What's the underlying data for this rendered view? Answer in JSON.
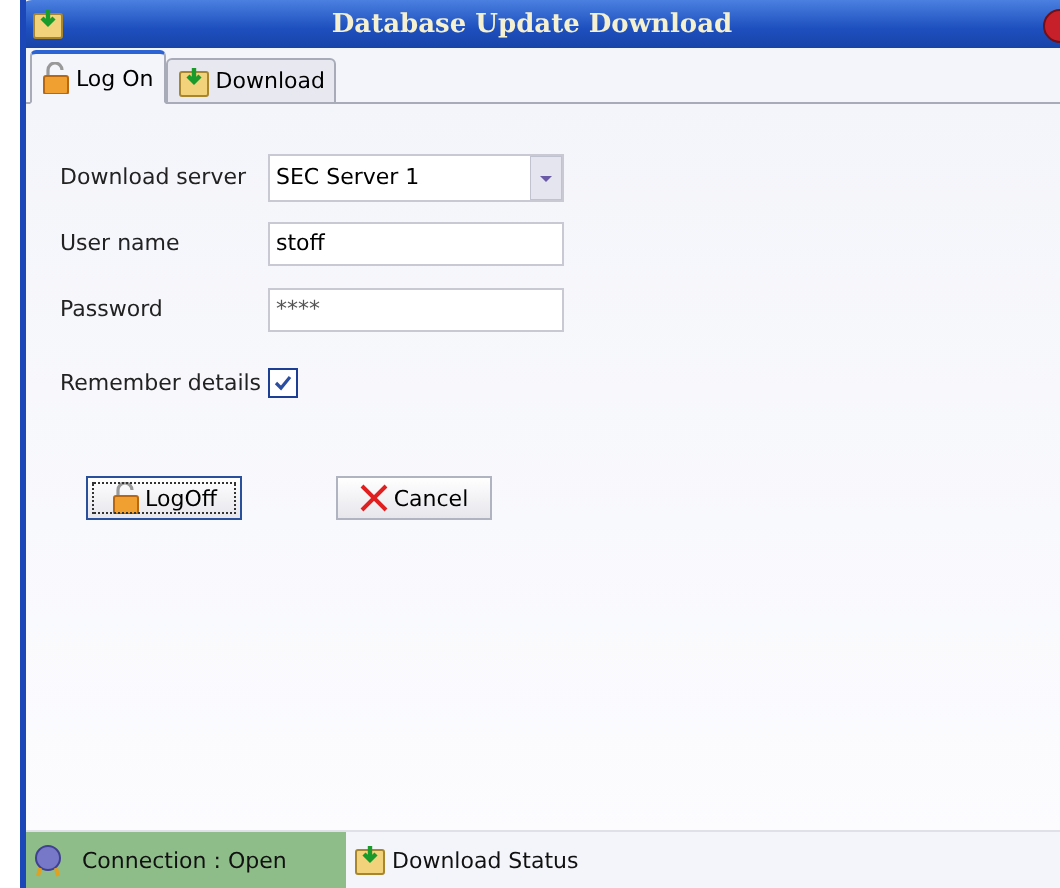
{
  "window": {
    "title": "Database Update Download"
  },
  "tabs": [
    {
      "label": "Log On",
      "kind": "lock",
      "selected": true
    },
    {
      "label": "Download",
      "kind": "download",
      "selected": false
    }
  ],
  "form": {
    "server": {
      "label": "Download server",
      "value": "SEC Server 1"
    },
    "username": {
      "label": "User name",
      "value": "stoff"
    },
    "password": {
      "label": "Password",
      "value": "****"
    },
    "remember": {
      "label": "Remember details",
      "checked": true
    }
  },
  "buttons": [
    {
      "label": "LogOff",
      "kind": "lock",
      "focused": true
    },
    {
      "label": "Cancel",
      "kind": "cross",
      "focused": false
    }
  ],
  "status_bar": {
    "connection": {
      "label": "Connection : Open",
      "open": true
    },
    "download": {
      "label": "Download Status"
    }
  }
}
